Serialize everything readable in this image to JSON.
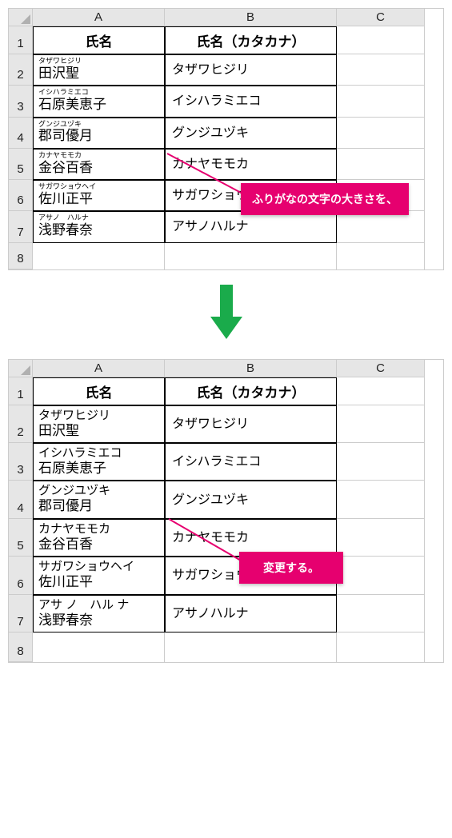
{
  "columns": {
    "A": "A",
    "B": "B",
    "C": "C"
  },
  "rownums": [
    "1",
    "2",
    "3",
    "4",
    "5",
    "6",
    "7",
    "8"
  ],
  "headers": {
    "name": "氏名",
    "katakana": "氏名（カタカナ）"
  },
  "rows": [
    {
      "furi": "タザワヒジリ",
      "kanji": "田沢聖",
      "kata": "タザワヒジリ"
    },
    {
      "furi": "イシハラミエコ",
      "kanji": "石原美恵子",
      "kata": "イシハラミエコ"
    },
    {
      "furi": "グンジユヅキ",
      "kanji": "郡司優月",
      "kata": "グンジユヅキ"
    },
    {
      "furi": "カナヤモモカ",
      "kanji": "金谷百香",
      "kata": "カナヤモモカ"
    },
    {
      "furi": "サガワショウヘイ",
      "kanji": "佐川正平",
      "kata": "サガワショウヘイ"
    },
    {
      "furi": "アサノ　ハルナ",
      "kanji": "浅野春奈",
      "kata": "アサノハルナ"
    }
  ],
  "rows2_furi5": "アサ ノ　ハル ナ",
  "callout1": "ふりがなの文字の大きさを、",
  "callout2": "変更する。",
  "colors": {
    "accent": "#e6006f",
    "arrow": "#1aab4b"
  }
}
